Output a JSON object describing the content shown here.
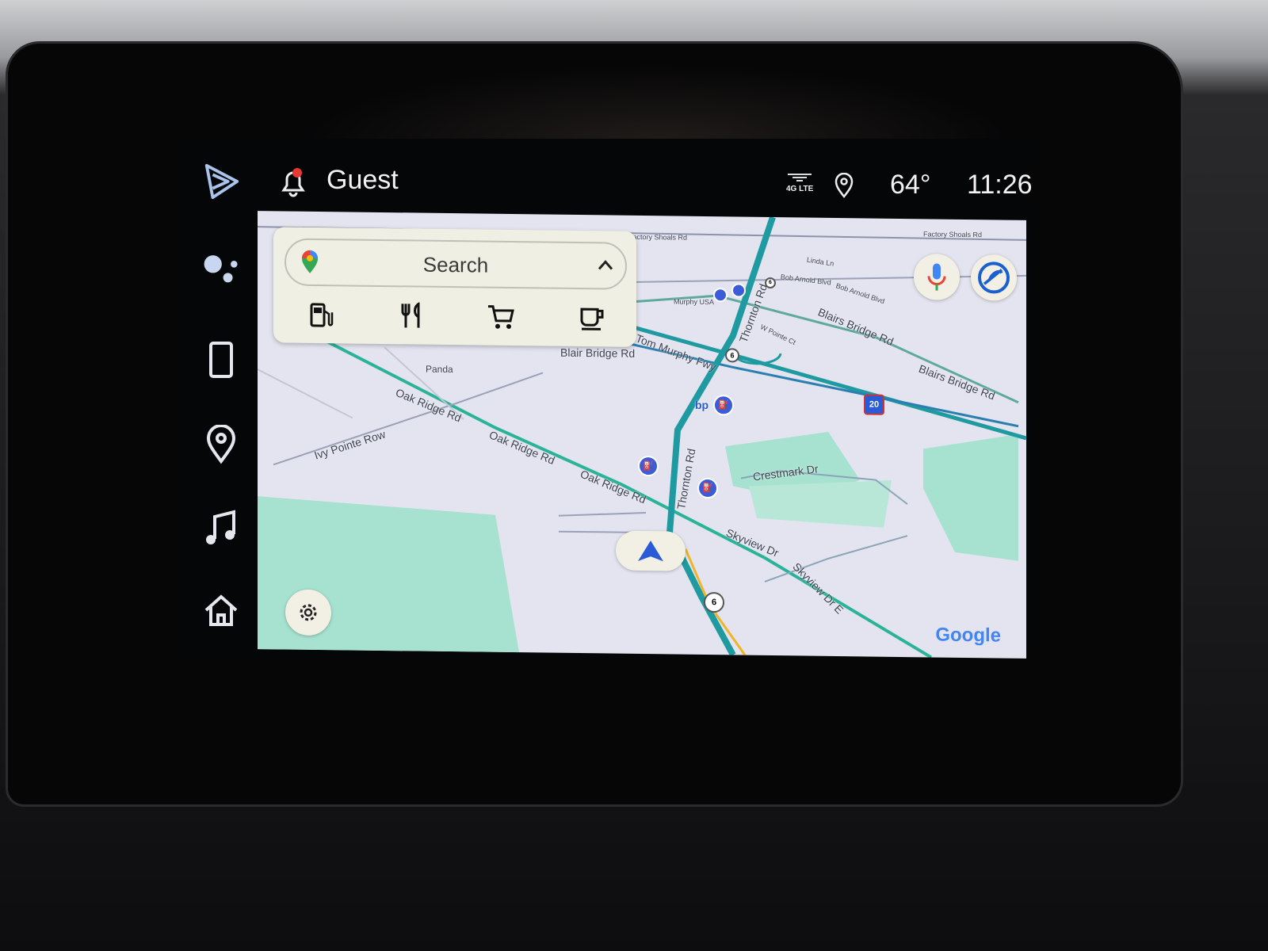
{
  "status_bar": {
    "user": "Guest",
    "network": "4G LTE",
    "temperature": "64°",
    "time": "11:26",
    "notification_dot_color": "#e53935"
  },
  "rail": {
    "items": [
      {
        "icon": "android-auto-icon"
      },
      {
        "icon": "google-assistant-icon"
      },
      {
        "icon": "phone-icon"
      },
      {
        "icon": "location-pin-icon"
      },
      {
        "icon": "music-note-icon"
      },
      {
        "icon": "home-icon"
      }
    ]
  },
  "search": {
    "placeholder": "Search",
    "categories": [
      "gas-station-icon",
      "restaurant-icon",
      "grocery-cart-icon",
      "coffee-icon"
    ]
  },
  "map": {
    "labels": {
      "factory_shoals_1": "Factory Shoals Rd",
      "factory_shoals_2": "Factory Shoals Rd",
      "linda": "Linda Ln",
      "bob_arnold_1": "Bob Arnold Blvd",
      "bob_arnold_2": "Bob Arnold Blvd",
      "murphy": "Murphy USA",
      "blairs_1": "Blairs Bridge Rd",
      "blairs_2": "Blairs Bridge Rd",
      "blair_bridge": "Blair Bridge Rd",
      "w_pointe": "W Pointe Ct",
      "thornton_1": "Thornton Rd",
      "thornton_2": "Thornton Rd",
      "tom_murphy": "Tom Murphy Fwy",
      "panda": "Panda",
      "oak_ridge_1": "Oak Ridge Rd",
      "oak_ridge_2": "Oak Ridge Rd",
      "oak_ridge_3": "Oak Ridge Rd",
      "ivy_pointe": "Ivy Pointe Row",
      "crestmark": "Crestmark Dr",
      "skyview_1": "Skyview Dr",
      "skyview_2": "Skyview Dr E",
      "bp": "bp"
    },
    "shields": {
      "interstate": "20",
      "route_a": "6",
      "route_b": "6",
      "route_c": "6"
    },
    "attribution": "Google",
    "colors": {
      "route": "#2bb39a",
      "highway": "#1e9aa0",
      "park": "#a7e2d0",
      "land": "#e3e4ef",
      "nav_arrow": "#2a5bd7"
    }
  }
}
